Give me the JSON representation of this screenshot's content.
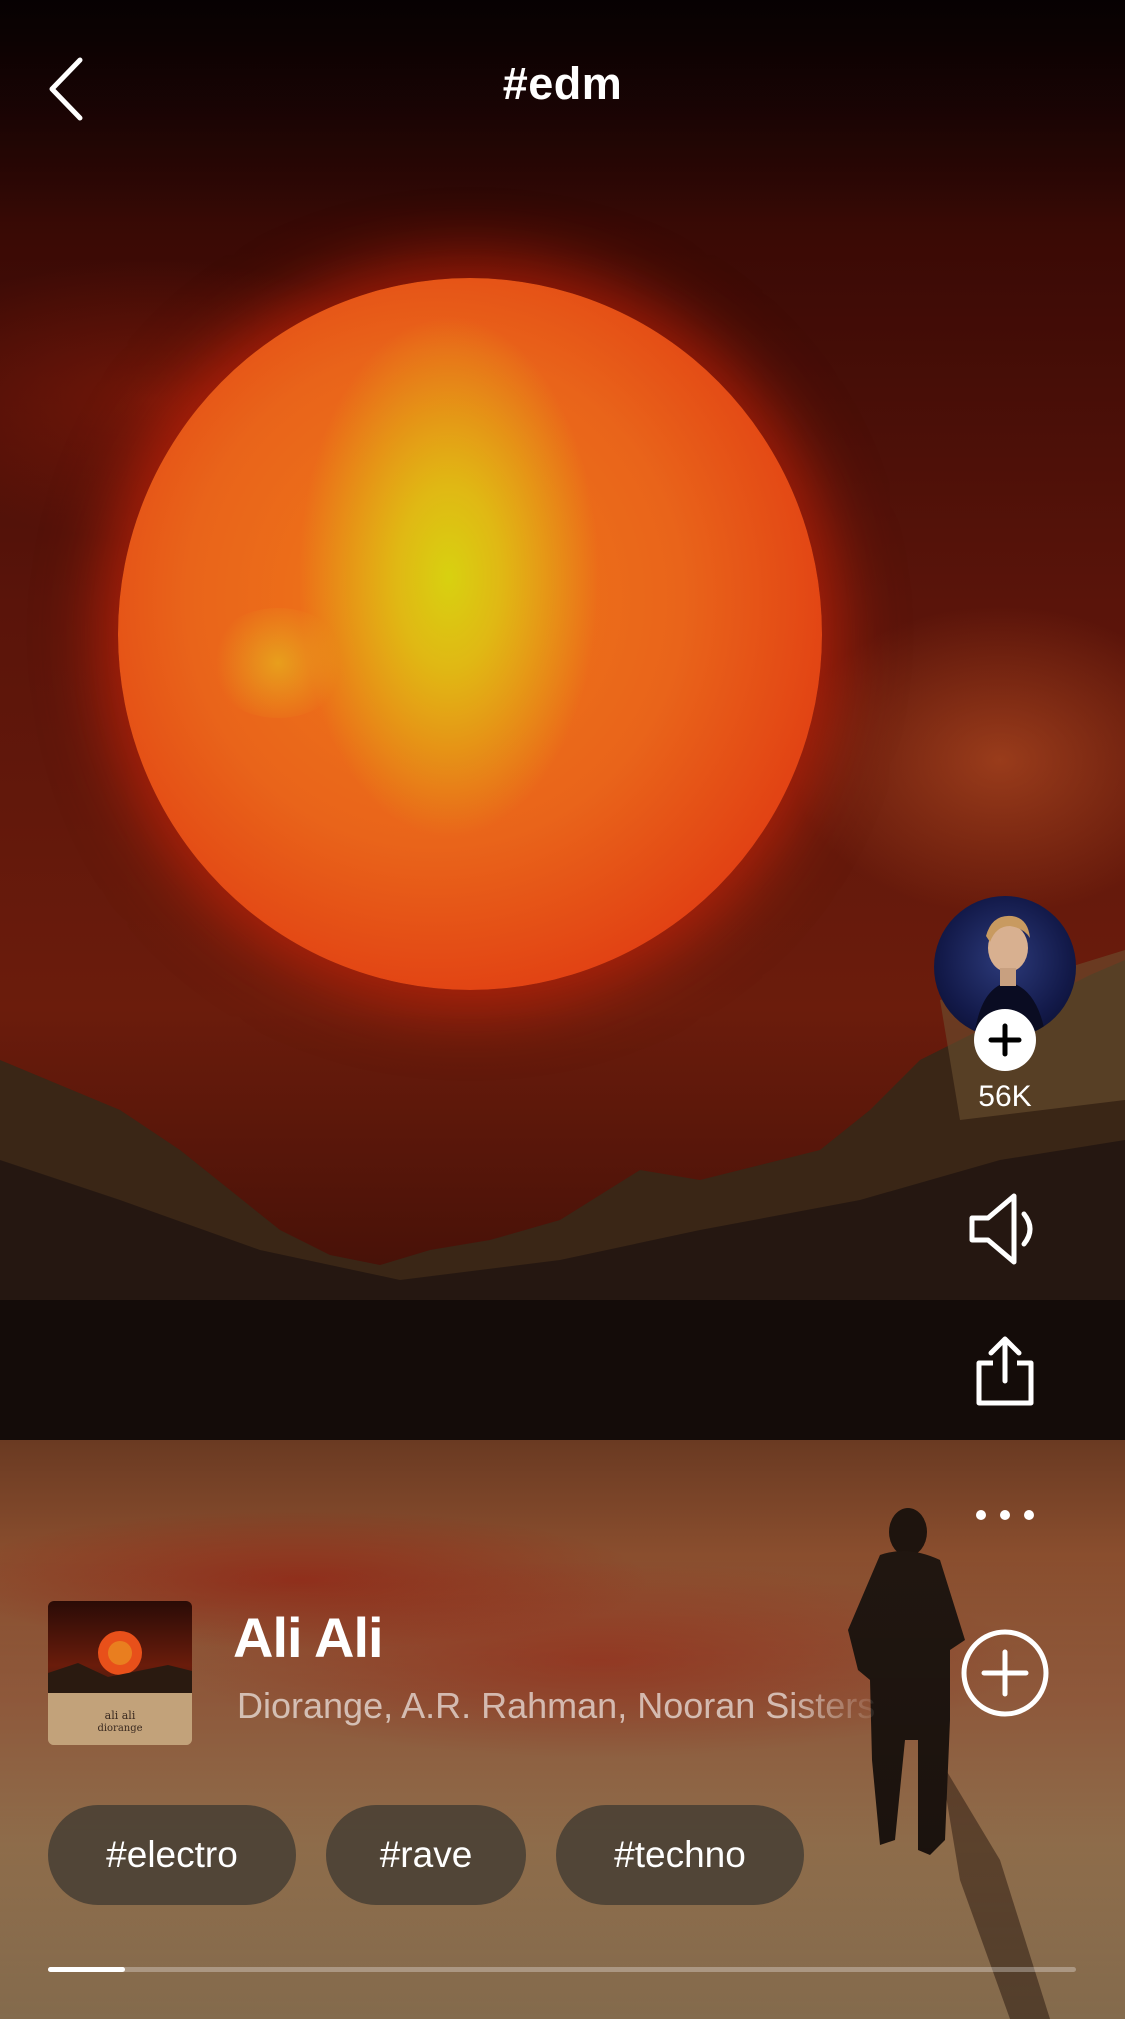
{
  "header": {
    "title": "#edm"
  },
  "icons": {
    "back": "chevron-left-icon",
    "follow": "plus-icon",
    "volume": "speaker-icon",
    "share": "share-icon",
    "more": "more-horizontal-icon",
    "add": "plus-circle-icon"
  },
  "artist": {
    "follower_count": "56K"
  },
  "track": {
    "title": "Ali Ali",
    "artists": "Diorange, A.R. Rahman, Nooran Sisters",
    "cover_text_line1": "ali ali",
    "cover_text_line2": "diorange"
  },
  "tags": [
    "#electro",
    "#rave",
    "#techno"
  ],
  "playback": {
    "progress_fraction": 0.075
  },
  "colors": {
    "text": "#ffffff",
    "tag_bg": "#463e34",
    "sun": "#f07a18",
    "sky": "#5a140a"
  }
}
